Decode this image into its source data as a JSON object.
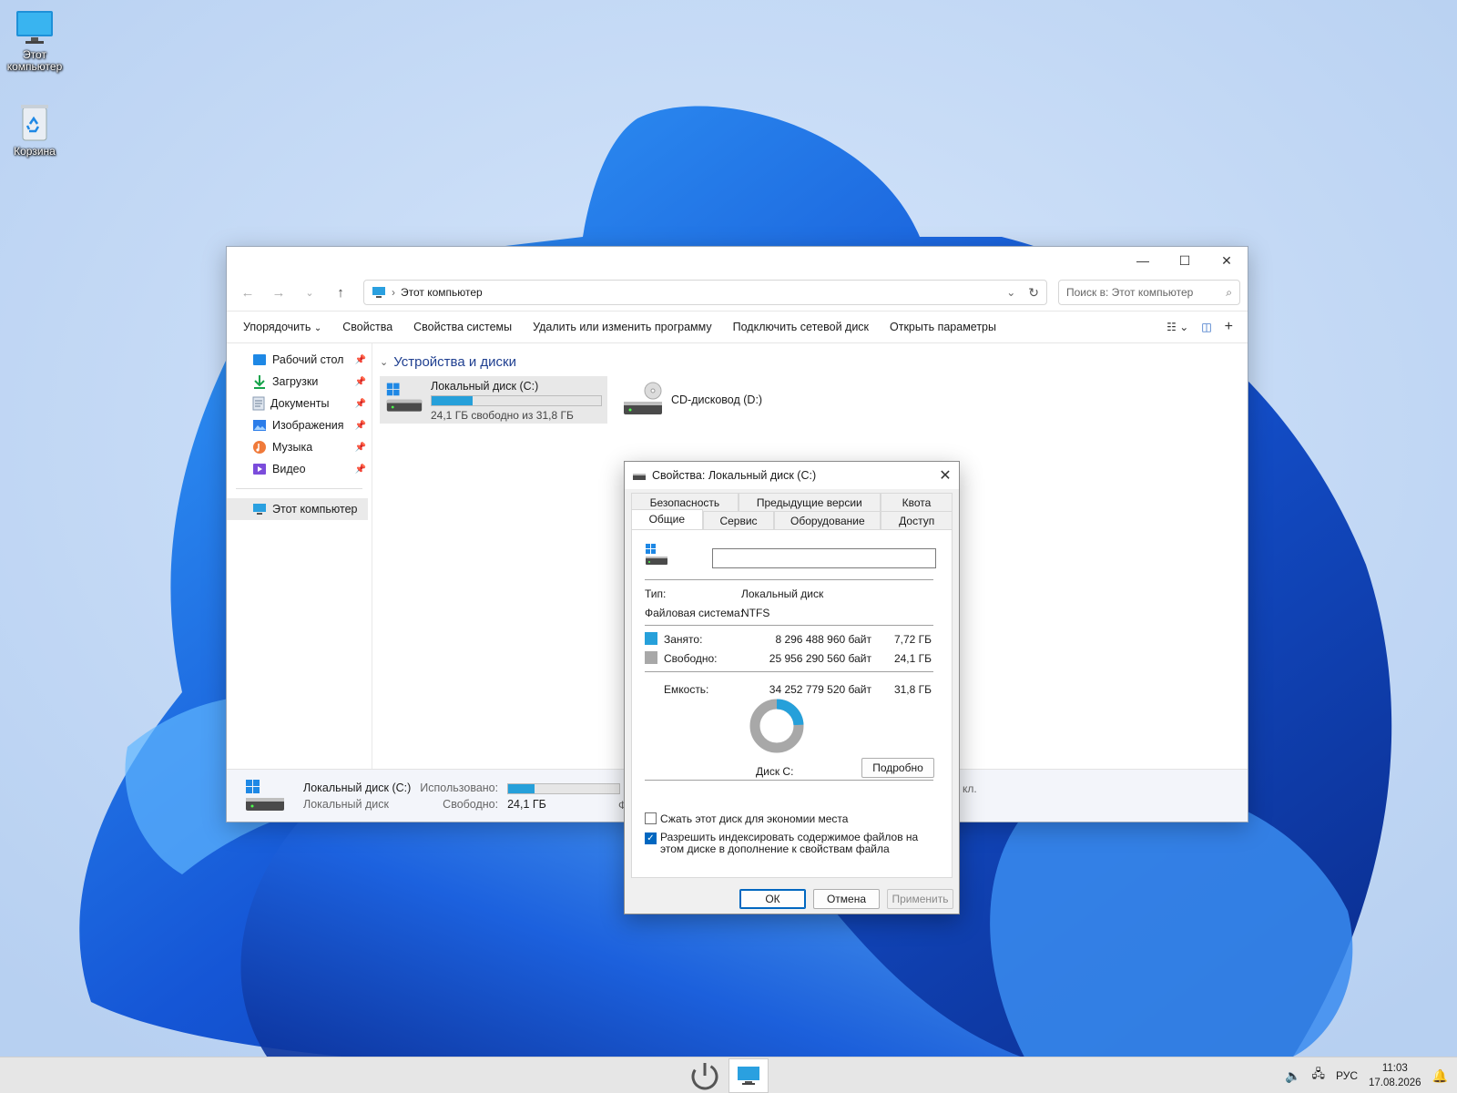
{
  "desktop": {
    "icons": [
      {
        "label": "Этот компьютер",
        "icon": "computer-icon"
      },
      {
        "label": "Корзина",
        "icon": "recycle-bin-icon"
      }
    ]
  },
  "explorer": {
    "address": "Этот компьютер",
    "search_placeholder": "Поиск в: Этот компьютер",
    "commands": [
      "Упорядочить",
      "Свойства",
      "Свойства системы",
      "Удалить или изменить программу",
      "Подключить сетевой диск",
      "Открыть параметры"
    ],
    "nav": [
      {
        "label": "Рабочий стол",
        "icon": "desktop-folder-icon",
        "pinned": true
      },
      {
        "label": "Загрузки",
        "icon": "downloads-icon",
        "pinned": true
      },
      {
        "label": "Документы",
        "icon": "documents-icon",
        "pinned": true
      },
      {
        "label": "Изображения",
        "icon": "pictures-icon",
        "pinned": true
      },
      {
        "label": "Музыка",
        "icon": "music-icon",
        "pinned": true
      },
      {
        "label": "Видео",
        "icon": "video-icon",
        "pinned": true
      }
    ],
    "nav_this_pc": "Этот компьютер",
    "group_title": "Устройства и диски",
    "drives": [
      {
        "name": "Локальный диск (C:)",
        "free_text": "24,1 ГБ свободно из 31,8 ГБ",
        "used_fraction": 0.24,
        "selected": true
      },
      {
        "name": "CD-дисковод (D:)"
      }
    ],
    "details": {
      "name": "Локальный диск (C:)",
      "type": "Локальный диск",
      "used_label": "Использовано:",
      "used_fraction": 0.24,
      "free_label": "Свободно:",
      "free_value": "24,1 ГБ",
      "trail_text": "Ф",
      "trail_text2": "кл."
    }
  },
  "dialog": {
    "title": "Свойства: Локальный диск (C:)",
    "tabs_row1": [
      "Безопасность",
      "Предыдущие версии",
      "Квота"
    ],
    "tabs_row2": [
      "Общие",
      "Сервис",
      "Оборудование",
      "Доступ"
    ],
    "active_tab": "Общие",
    "name_value": "",
    "type_label": "Тип:",
    "type_value": "Локальный диск",
    "fs_label": "Файловая система:",
    "fs_value": "NTFS",
    "used_label": "Занято:",
    "used_bytes": "8 296 488 960 байт",
    "used_gb": "7,72 ГБ",
    "free_label": "Свободно:",
    "free_bytes": "25 956 290 560 байт",
    "free_gb": "24,1 ГБ",
    "capacity_label": "Емкость:",
    "capacity_bytes": "34 252 779 520 байт",
    "capacity_gb": "31,8 ГБ",
    "disk_label": "Диск С:",
    "details_button": "Подробно",
    "compress_label": "Сжать этот диск для экономии места",
    "compress_checked": false,
    "index_label": "Разрешить индексировать содержимое файлов на этом диске в дополнение к свойствам файла",
    "index_checked": true,
    "ok": "ОК",
    "cancel": "Отмена",
    "apply": "Применить",
    "colors": {
      "used": "#26a0da",
      "free": "#a8a8a8"
    },
    "used_fraction": 0.2422
  },
  "taskbar": {
    "lang": "РУС",
    "time": "11:03",
    "date": "17.08.2026"
  }
}
